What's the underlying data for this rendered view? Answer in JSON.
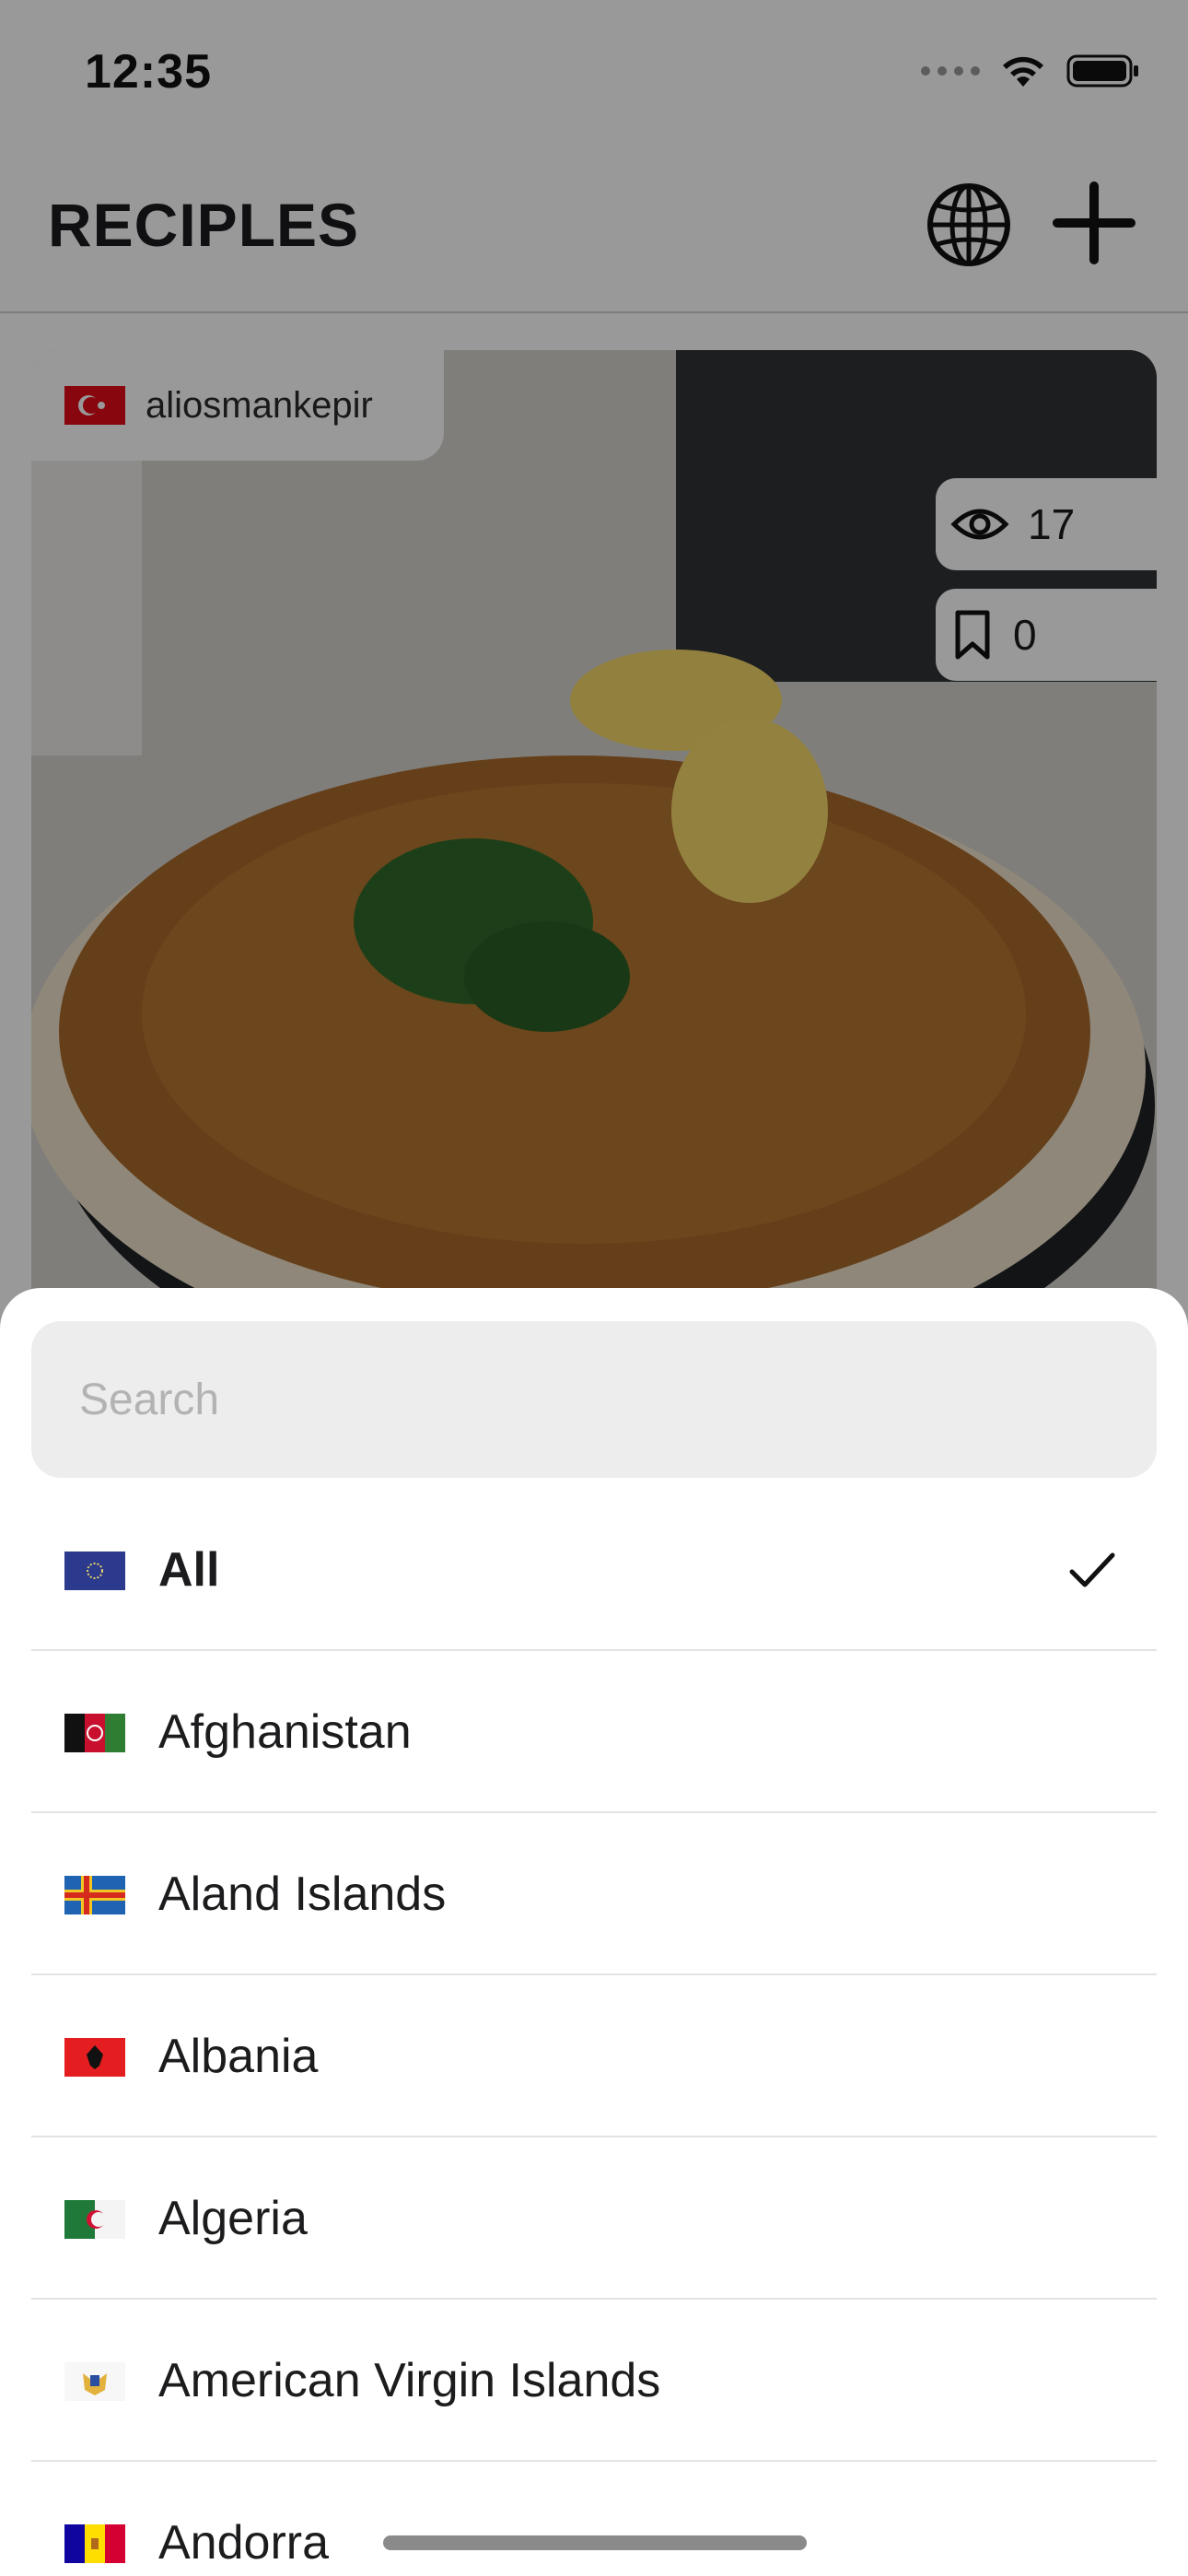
{
  "status_bar": {
    "time": "12:35",
    "icons": [
      "signal-dots-icon",
      "wifi-icon",
      "battery-icon"
    ]
  },
  "nav": {
    "title": "RECIPLES",
    "actions": [
      "globe-icon",
      "plus-icon"
    ]
  },
  "recipe_card": {
    "author": "aliosmankepir",
    "author_flag": "flag-turkey-icon",
    "views": "17",
    "saves": "0"
  },
  "country_sheet": {
    "search_placeholder": "Search",
    "countries": [
      {
        "label": "All",
        "flag": "flag-eu-icon",
        "selected": true
      },
      {
        "label": "Afghanistan",
        "flag": "flag-afghanistan-icon",
        "selected": false
      },
      {
        "label": "Aland Islands",
        "flag": "flag-aland-islands-icon",
        "selected": false
      },
      {
        "label": "Albania",
        "flag": "flag-albania-icon",
        "selected": false
      },
      {
        "label": "Algeria",
        "flag": "flag-algeria-icon",
        "selected": false
      },
      {
        "label": "American Virgin Islands",
        "flag": "flag-us-virgin-islands-icon",
        "selected": false
      },
      {
        "label": "Andorra",
        "flag": "flag-andorra-icon",
        "selected": false
      }
    ]
  },
  "colors": {
    "overlay": "#00000066",
    "sheet_background": "#ffffff",
    "search_background": "#ededed",
    "divider": "#e3e3e3",
    "text": "#1c1c1e"
  }
}
